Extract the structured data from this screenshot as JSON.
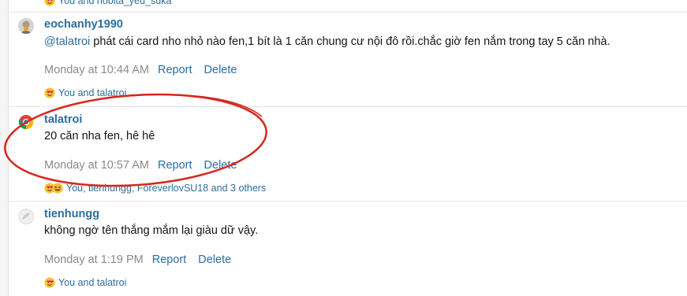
{
  "top_partial": {
    "reactions_text": "You and nobita_yeu_suka"
  },
  "comments": [
    {
      "username": "eochanhy1990",
      "mention": "@talatroi",
      "text": " phát cái card nho nhỏ nào fen,1 bít là 1 căn chung cư nội đô rồi.chắc giờ fen nắm trong tay 5 căn nhà.",
      "time": "Monday at 10:44 AM",
      "report_label": "Report",
      "delete_label": "Delete",
      "reactions_text": "You and talatroi"
    },
    {
      "username": "talatroi",
      "text": "20 căn nha fen, hê hê",
      "time": "Monday at 10:57 AM",
      "report_label": "Report",
      "delete_label": "Delete",
      "reactions_text": "You, tienhungg, ForeverlovSU18 and 3 others"
    },
    {
      "username": "tienhungg",
      "text": "không ngờ tên thắng mắm lại giàu dữ vậy.",
      "time": "Monday at 1:19 PM",
      "report_label": "Report",
      "delete_label": "Delete",
      "reactions_text": "You and talatroi"
    }
  ],
  "icons": {
    "reaction": "love-emoji-icon",
    "reaction_secondary": "haha-emoji-icon"
  },
  "colors": {
    "link": "#2b6ea0",
    "highlight": "#d9251d",
    "muted": "#8a8a8a"
  }
}
